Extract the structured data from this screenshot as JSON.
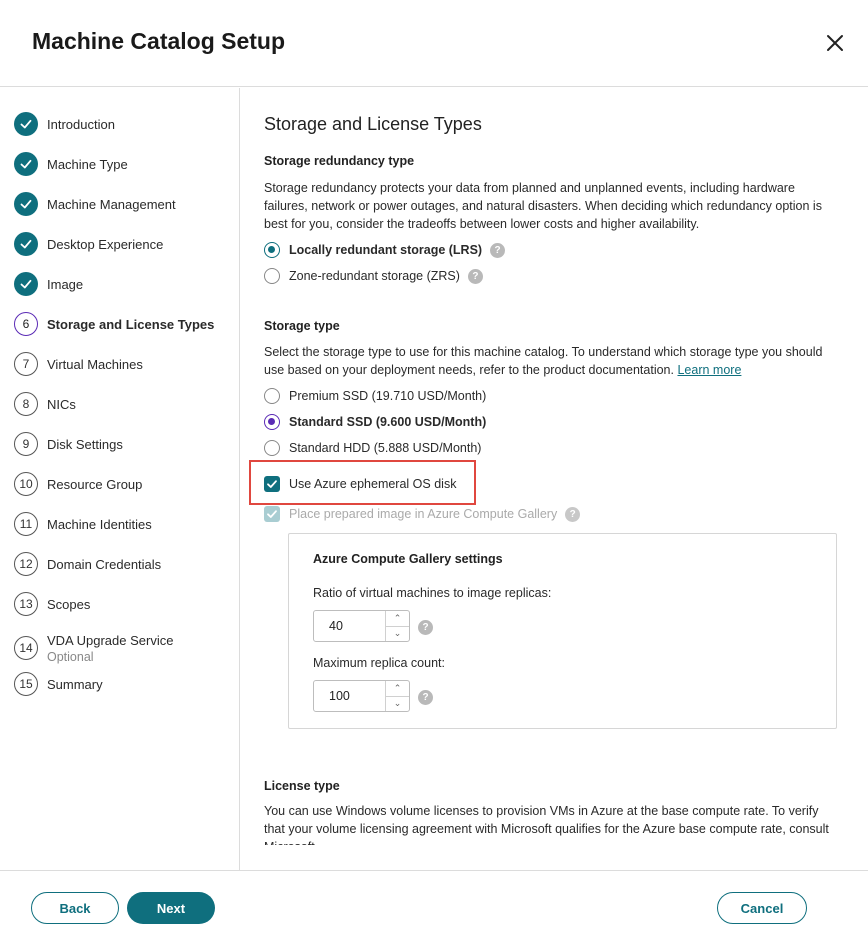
{
  "header": {
    "title": "Machine Catalog Setup"
  },
  "steps": [
    {
      "num": "",
      "label": "Introduction",
      "state": "done"
    },
    {
      "num": "",
      "label": "Machine Type",
      "state": "done"
    },
    {
      "num": "",
      "label": "Machine Management",
      "state": "done"
    },
    {
      "num": "",
      "label": "Desktop Experience",
      "state": "done"
    },
    {
      "num": "",
      "label": "Image",
      "state": "done"
    },
    {
      "num": "6",
      "label": "Storage and License Types",
      "state": "current"
    },
    {
      "num": "7",
      "label": "Virtual Machines",
      "state": "todo"
    },
    {
      "num": "8",
      "label": "NICs",
      "state": "todo"
    },
    {
      "num": "9",
      "label": "Disk Settings",
      "state": "todo"
    },
    {
      "num": "10",
      "label": "Resource Group",
      "state": "todo"
    },
    {
      "num": "11",
      "label": "Machine Identities",
      "state": "todo"
    },
    {
      "num": "12",
      "label": "Domain Credentials",
      "state": "todo"
    },
    {
      "num": "13",
      "label": "Scopes",
      "state": "todo"
    },
    {
      "num": "14",
      "label": "VDA Upgrade Service",
      "sub": "Optional",
      "state": "todo"
    },
    {
      "num": "15",
      "label": "Summary",
      "state": "todo"
    }
  ],
  "main": {
    "heading": "Storage and License Types",
    "redundancy": {
      "title": "Storage redundancy type",
      "description": "Storage redundancy protects your data from planned and unplanned events, including hardware failures, network or power outages, and natural disasters. When deciding which redundancy option is best for you, consider the tradeoffs between lower costs and higher availability.",
      "options": [
        {
          "label": "Locally redundant storage (LRS)",
          "selected": true
        },
        {
          "label": "Zone-redundant storage (ZRS)",
          "selected": false
        }
      ]
    },
    "storage": {
      "title": "Storage type",
      "description": "Select the storage type to use for this machine catalog. To understand which storage type you should use based on your deployment needs, refer to the product documentation.",
      "learn_more": "Learn more",
      "options": [
        {
          "label": "Premium SSD (19.710 USD/Month)",
          "selected": false
        },
        {
          "label": "Standard SSD (9.600 USD/Month)",
          "selected": true
        },
        {
          "label": "Standard HDD (5.888 USD/Month)",
          "selected": false
        }
      ]
    },
    "ephemeral_checkbox": {
      "label": "Use Azure ephemeral OS disk",
      "checked": true
    },
    "gallery_checkbox": {
      "label": "Place prepared image in Azure Compute Gallery",
      "checked": true,
      "disabled": true
    },
    "gallery": {
      "title": "Azure Compute Gallery settings",
      "ratio_label": "Ratio of virtual machines to image replicas:",
      "ratio_value": "40",
      "max_label": "Maximum replica count:",
      "max_value": "100"
    },
    "license": {
      "title": "License type",
      "description": "You can use Windows volume licenses to provision VMs in Azure at the base compute rate. To verify that your volume licensing agreement with Microsoft qualifies for the Azure base compute rate, consult Microsoft."
    }
  },
  "footer": {
    "back": "Back",
    "next": "Next",
    "cancel": "Cancel"
  },
  "colors": {
    "accent": "#0f6f7e",
    "current_step": "#5a2ab5",
    "highlight": "#e0473f"
  }
}
